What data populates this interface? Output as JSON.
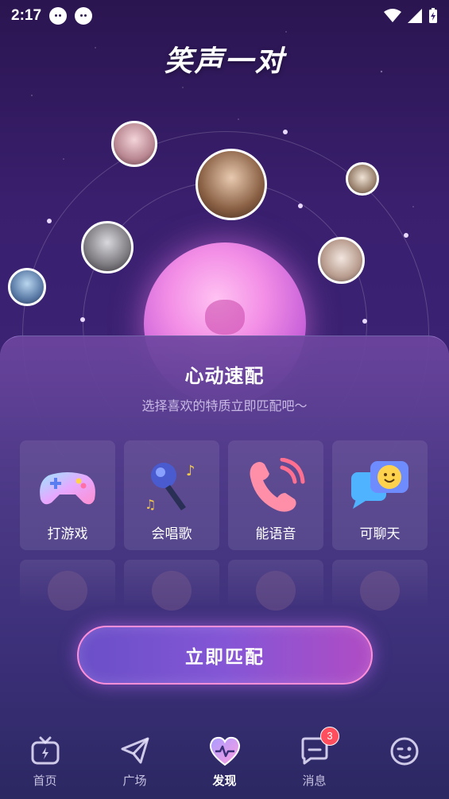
{
  "status_bar": {
    "time": "2:17"
  },
  "app": {
    "logo_text": "笑声一对"
  },
  "match_panel": {
    "title": "心动速配",
    "subtitle": "选择喜欢的特质立即匹配吧～",
    "traits": [
      {
        "label": "打游戏",
        "icon": "gamepad-icon"
      },
      {
        "label": "会唱歌",
        "icon": "microphone-icon"
      },
      {
        "label": "能语音",
        "icon": "phone-icon"
      },
      {
        "label": "可聊天",
        "icon": "chat-icon"
      }
    ],
    "match_button": "立即匹配"
  },
  "nav": {
    "items": [
      {
        "label": "首页",
        "icon": "tv-icon"
      },
      {
        "label": "广场",
        "icon": "paper-plane-icon"
      },
      {
        "label": "发现",
        "icon": "heart-pulse-icon",
        "active": true
      },
      {
        "label": "消息",
        "icon": "message-icon",
        "badge": "3"
      },
      {
        "label": "",
        "icon": "emoji-face-icon"
      }
    ]
  },
  "colors": {
    "accent_pink": "#ff8fd9",
    "badge_red": "#ff4f5e",
    "background": "#3a1f6e"
  }
}
